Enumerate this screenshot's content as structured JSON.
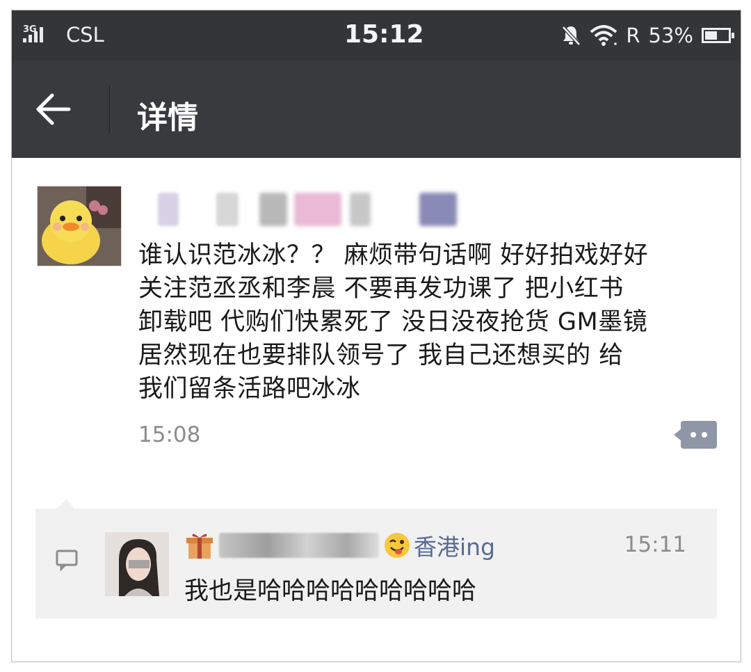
{
  "status_bar": {
    "network": "3G",
    "carrier": "CSL",
    "time": "15:12",
    "roaming": "R",
    "battery_percent": "53%",
    "battery_level": 0.53,
    "icons": [
      "signal-icon",
      "mute-bell-icon",
      "wifi-icon",
      "battery-icon"
    ]
  },
  "app_bar": {
    "title": "详情",
    "back_icon": "arrow-left-icon"
  },
  "post": {
    "text": "谁认识范冰冰？？ 麻烦带句话啊 好好拍戏好好\n关注范丞丞和李晨 不要再发功课了 把小红书\n卸载吧 代购们快累死了 没日没夜抢货 GM墨镜\n居然现在也要排队领号了 我自己还想买的 给\n我们留条活路吧冰冰",
    "time": "15:08",
    "more_icon": "more-dots-icon"
  },
  "comments": [
    {
      "author_suffix": "香港ing",
      "time": "15:11",
      "text": "我也是哈哈哈哈哈哈哈哈哈"
    }
  ],
  "colors": {
    "status_bar": "#343537",
    "app_bar": "#393a3e",
    "link_blue": "#576b95",
    "comment_bg": "#f1f1f1",
    "muted_text": "#8c8c8c"
  }
}
